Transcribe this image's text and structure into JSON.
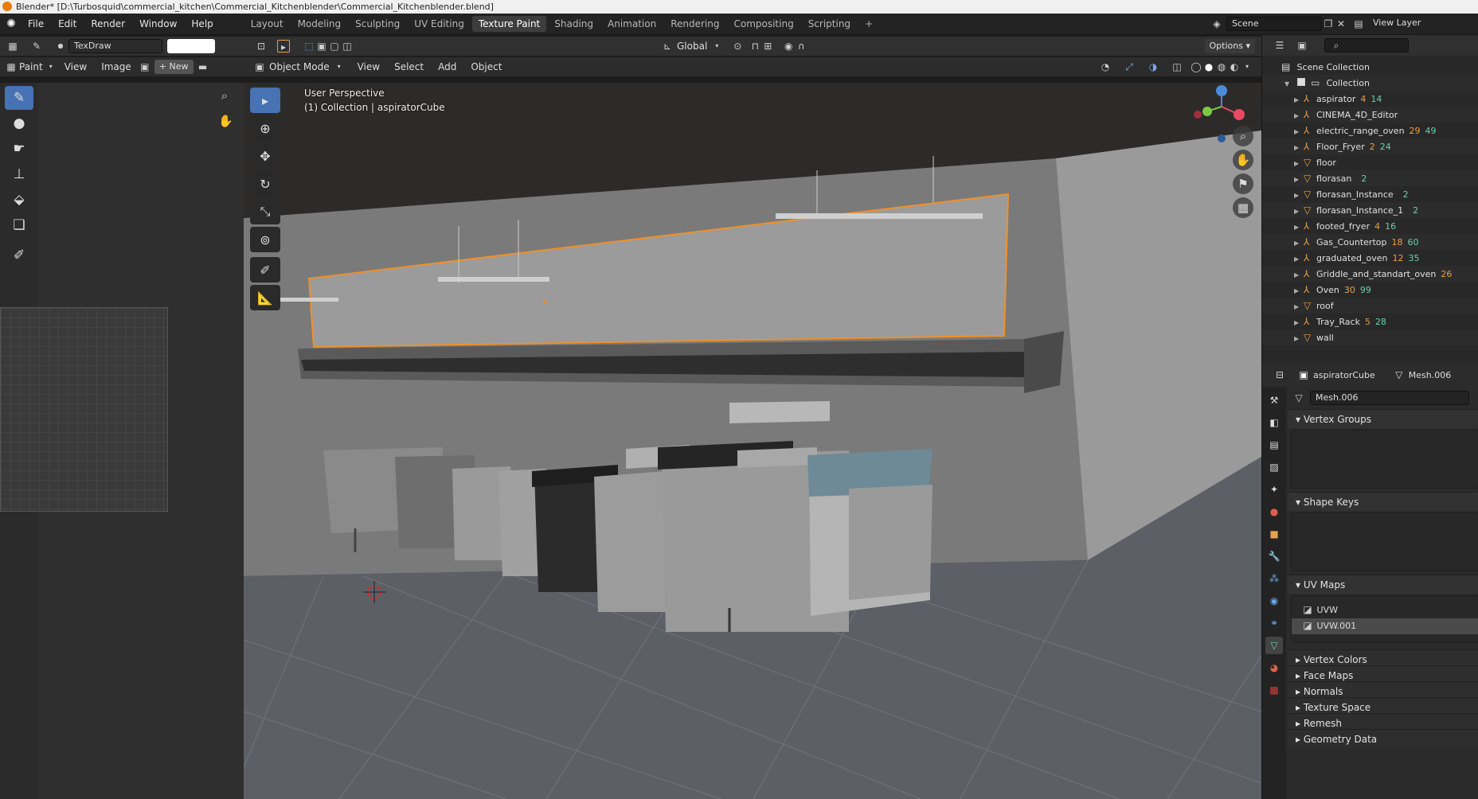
{
  "window": {
    "title": "Blender* [D:\\Turbosquid\\commercial_kitchen\\Commercial_Kitchenblender\\Commercial_Kitchenblender.blend]"
  },
  "menu": [
    "File",
    "Edit",
    "Render",
    "Window",
    "Help"
  ],
  "workspaces": [
    "Layout",
    "Modeling",
    "Sculpting",
    "UV Editing",
    "Texture Paint",
    "Shading",
    "Animation",
    "Rendering",
    "Compositing",
    "Scripting"
  ],
  "active_workspace": "Texture Paint",
  "scene": {
    "label": "Scene",
    "view_layer": "View Layer"
  },
  "image_editor": {
    "brush_name": "TexDraw",
    "mode": "Paint",
    "menus": [
      "View",
      "Image"
    ],
    "new_label": "New"
  },
  "viewport": {
    "orientation": "Global",
    "options_label": "Options",
    "mode": "Object Mode",
    "menus": [
      "View",
      "Select",
      "Add",
      "Object"
    ],
    "overlay_line1": "User Perspective",
    "overlay_line2": "(1) Collection | aspiratorCube",
    "gizmo_colors": {
      "x": "#e84a5f",
      "y": "#7ac943",
      "z": "#4b8bd8"
    }
  },
  "outliner": {
    "root": "Scene Collection",
    "collection": "Collection",
    "items": [
      {
        "name": "aspirator",
        "c1": "4",
        "c2": "14"
      },
      {
        "name": "CINEMA_4D_Editor",
        "c1": "",
        "c2": ""
      },
      {
        "name": "electric_range_oven",
        "c1": "29",
        "c2": "49"
      },
      {
        "name": "Floor_Fryer",
        "c1": "2",
        "c2": "24"
      },
      {
        "name": "floor",
        "c1": "",
        "c2": ""
      },
      {
        "name": "florasan",
        "c1": "",
        "c2": "2"
      },
      {
        "name": "florasan_Instance",
        "c1": "",
        "c2": "2"
      },
      {
        "name": "florasan_Instance_1",
        "c1": "",
        "c2": "2"
      },
      {
        "name": "footed_fryer",
        "c1": "4",
        "c2": "16"
      },
      {
        "name": "Gas_Countertop",
        "c1": "18",
        "c2": "60"
      },
      {
        "name": "graduated_oven",
        "c1": "12",
        "c2": "35"
      },
      {
        "name": "Griddle_and_standart_oven",
        "c1": "26",
        "c2": ""
      },
      {
        "name": "Oven",
        "c1": "30",
        "c2": "99"
      },
      {
        "name": "roof",
        "c1": "",
        "c2": ""
      },
      {
        "name": "Tray_Rack",
        "c1": "5",
        "c2": "28"
      },
      {
        "name": "wall",
        "c1": "",
        "c2": ""
      }
    ]
  },
  "properties": {
    "object": "aspiratorCube",
    "mesh": "Mesh.006",
    "datablock": "Mesh.006",
    "panels": {
      "vertex_groups": "Vertex Groups",
      "shape_keys": "Shape Keys",
      "uv_maps": "UV Maps"
    },
    "uv_maps": [
      "UVW",
      "UVW.001"
    ],
    "collapsed_panels": [
      "Vertex Colors",
      "Face Maps",
      "Normals",
      "Texture Space",
      "Remesh",
      "Geometry Data"
    ]
  }
}
